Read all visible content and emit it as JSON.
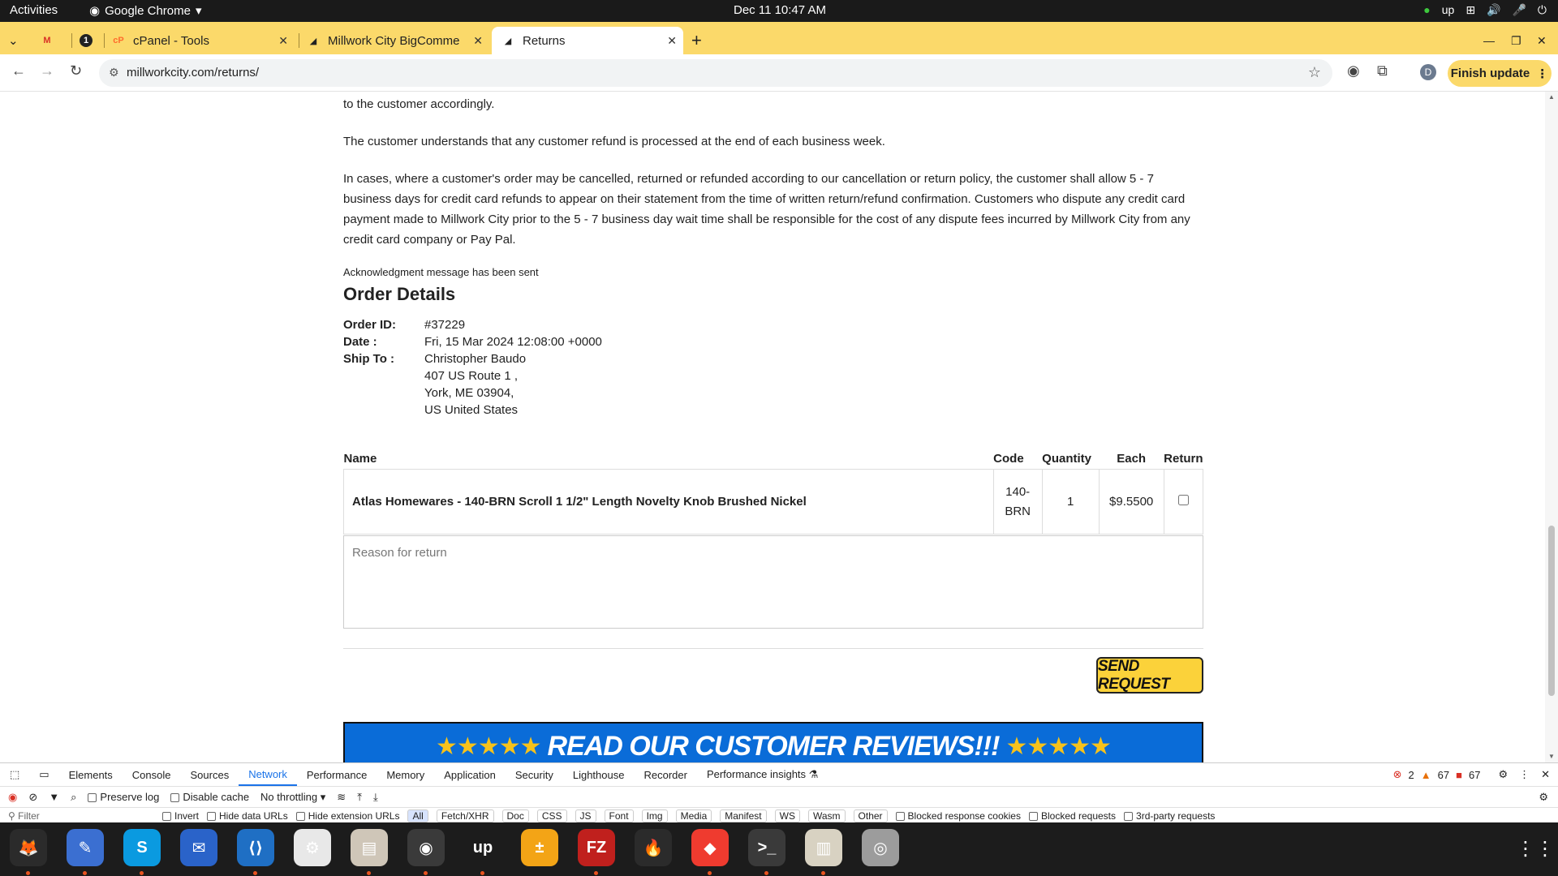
{
  "topbar": {
    "activities": "Activities",
    "app_name": "Google Chrome",
    "clock": "Dec 11  10:47 AM"
  },
  "tabs": [
    {
      "label": "",
      "fav": "M",
      "fav_color": "#d93025"
    },
    {
      "label": "",
      "fav": "1",
      "fav_color": "#c5221f"
    },
    {
      "label": "cPanel - Tools",
      "fav": "cP",
      "fav_color": "#ff6c2c"
    },
    {
      "label": "Millwork City BigComme",
      "fav": "◢",
      "fav_color": "#333333"
    },
    {
      "label": "Returns",
      "fav": "◢",
      "fav_color": "#333333"
    }
  ],
  "address": {
    "url": "millworkcity.com/returns/",
    "finish_update": "Finish update",
    "profile": "D"
  },
  "policy": {
    "p0": "to the customer accordingly.",
    "p1": "The customer understands that any customer refund is processed at the end of each business week.",
    "p2": "In cases, where a customer's order may be cancelled, returned or refunded according to our cancellation or return policy, the customer shall allow 5 - 7 business days for credit card refunds to appear on their statement from the time of written return/refund confirmation. Customers who dispute any credit card payment made to Millwork City prior to the 5 - 7 business day wait time shall be responsible for the cost of any dispute fees incurred by Millwork City from any credit card company or Pay Pal."
  },
  "ack_message": "Acknowledgment message has been sent",
  "order": {
    "heading": "Order Details",
    "id_label": "Order ID:",
    "id_value": "#37229",
    "date_label": "Date :",
    "date_value": "Fri, 15 Mar 2024 12:08:00 +0000",
    "ship_label": "Ship To :",
    "ship_name": "Christopher Baudo",
    "ship_line1": "407 US Route 1 ,",
    "ship_line2": "York, ME 03904,",
    "ship_line3": "US United States"
  },
  "table": {
    "headers": {
      "name": "Name",
      "code": "Code",
      "qty": "Quantity",
      "each": "Each",
      "ret": "Return"
    },
    "rows": [
      {
        "name": "Atlas Homewares - 140-BRN Scroll 1 1/2\" Length Novelty Knob Brushed Nickel",
        "code_a": "140-",
        "code_b": "BRN",
        "qty": "1",
        "each": "$9.5500"
      }
    ]
  },
  "reason_placeholder": "Reason for return",
  "send_request": "SEND REQUEST",
  "banner": "READ OUR CUSTOMER REVIEWS!!!",
  "banner_stars": "★★★★★",
  "devtools": {
    "tabs": [
      "Elements",
      "Console",
      "Sources",
      "Network",
      "Performance",
      "Memory",
      "Application",
      "Security",
      "Lighthouse",
      "Recorder",
      "Performance insights ⚗"
    ],
    "active_tab": "Network",
    "counts": {
      "errors": "2",
      "warnings": "67",
      "issues": "67"
    },
    "preserve_log": "Preserve log",
    "disable_cache": "Disable cache",
    "throttling": "No throttling",
    "filter_placeholder": "Filter",
    "invert": "Invert",
    "hide_data_urls": "Hide data URLs",
    "hide_ext_urls": "Hide extension URLs",
    "chips": [
      "All",
      "Fetch/XHR",
      "Doc",
      "CSS",
      "JS",
      "Font",
      "Img",
      "Media",
      "Manifest",
      "WS",
      "Wasm",
      "Other"
    ],
    "blocked_cookies": "Blocked response cookies",
    "blocked_requests": "Blocked requests",
    "third_party": "3rd-party requests"
  },
  "dock": [
    {
      "name": "firefox-icon",
      "glyph": "🦊",
      "bg": "#2b2b2b",
      "dot": true
    },
    {
      "name": "text-editor-icon",
      "glyph": "✎",
      "bg": "#3b6fd1",
      "dot": true
    },
    {
      "name": "skype-icon",
      "glyph": "S",
      "bg": "#0a9ae0",
      "dot": true
    },
    {
      "name": "thunderbird-icon",
      "glyph": "✉",
      "bg": "#2a63c9",
      "dot": false
    },
    {
      "name": "vscode-icon",
      "glyph": "⟨⟩",
      "bg": "#1f6fc4",
      "dot": true
    },
    {
      "name": "settings-icon",
      "glyph": "⚙",
      "bg": "#e8e8e8",
      "dot": false
    },
    {
      "name": "files-icon",
      "glyph": "▤",
      "bg": "#cfc6b8",
      "dot": true
    },
    {
      "name": "chrome-icon",
      "glyph": "◉",
      "bg": "#3a3a3a",
      "dot": true
    },
    {
      "name": "upwork-icon",
      "glyph": "up",
      "bg": "#1c1c1c",
      "dot": true
    },
    {
      "name": "calculator-icon",
      "glyph": "±",
      "bg": "#f3a416",
      "dot": false
    },
    {
      "name": "filezilla-icon",
      "glyph": "FZ",
      "bg": "#c0201d",
      "dot": true
    },
    {
      "name": "burner-icon",
      "glyph": "🔥",
      "bg": "#2b2b2b",
      "dot": false
    },
    {
      "name": "anydesk-icon",
      "glyph": "◆",
      "bg": "#ef3b2f",
      "dot": true
    },
    {
      "name": "terminal-icon",
      "glyph": ">_",
      "bg": "#3a3a3a",
      "dot": true
    },
    {
      "name": "archive-icon",
      "glyph": "▥",
      "bg": "#d8d2c2",
      "dot": true
    },
    {
      "name": "disk-icon",
      "glyph": "◎",
      "bg": "#9c9c9c",
      "dot": false
    }
  ]
}
